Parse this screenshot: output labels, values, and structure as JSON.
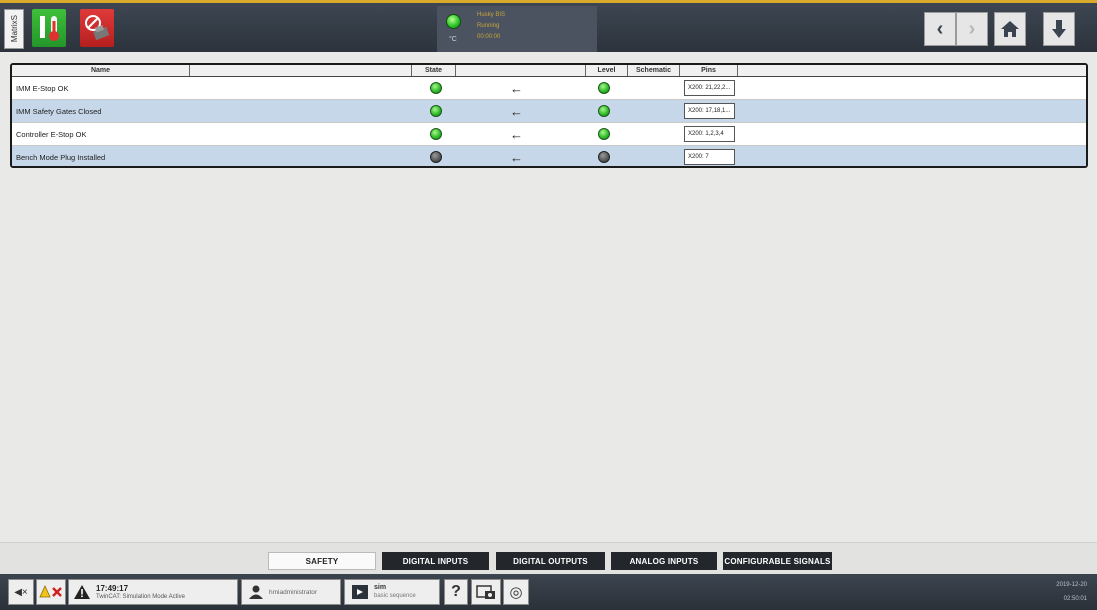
{
  "app": {
    "side_tab_label": "MatrixS",
    "accent_color": "#d8a92a"
  },
  "header": {
    "heat_button_icon": "thermometer-icon",
    "mold_button_icon": "mold-off-icon",
    "status": {
      "led_color": "#2fc42b",
      "unit": "°C",
      "machine": "Husky BIS",
      "state": "Running",
      "timer": "00:00:00"
    },
    "nav": {
      "back_icon": "chevron-left-icon",
      "forward_icon": "chevron-right-icon",
      "home_icon": "home-icon",
      "down_icon": "arrow-down-icon"
    }
  },
  "table": {
    "columns": {
      "name": "Name",
      "state": "State",
      "level": "Level",
      "schematic": "Schematic",
      "pins": "Pins"
    },
    "rows": [
      {
        "name": "IMM E-Stop OK",
        "state": "on",
        "level": "on",
        "pins": "X200: 21,22,2..."
      },
      {
        "name": "IMM Safety Gates Closed",
        "state": "on",
        "level": "on",
        "pins": "X200: 17,18,1..."
      },
      {
        "name": "Controller E-Stop OK",
        "state": "on",
        "level": "on",
        "pins": "X200: 1,2,3,4"
      },
      {
        "name": "Bench Mode Plug Installed",
        "state": "off",
        "level": "off",
        "pins": "X200: 7"
      }
    ]
  },
  "tabs": [
    {
      "label": "SAFETY",
      "active": true
    },
    {
      "label": "DIGITAL INPUTS",
      "active": false
    },
    {
      "label": "DIGITAL OUTPUTS",
      "active": false
    },
    {
      "label": "ANALOG INPUTS",
      "active": false
    },
    {
      "label": "CONFIGURABLE SIGNALS",
      "active": false
    }
  ],
  "statusbar": {
    "alarm_time": "17:49:17",
    "alarm_message": "TwinCAT: Simulation Mode Active",
    "user": "hmiadministrator",
    "sim_title": "sim",
    "sim_subtitle": "basic sequence",
    "help_label": "?",
    "date": "2019-12-20",
    "time": "02:50:01"
  }
}
